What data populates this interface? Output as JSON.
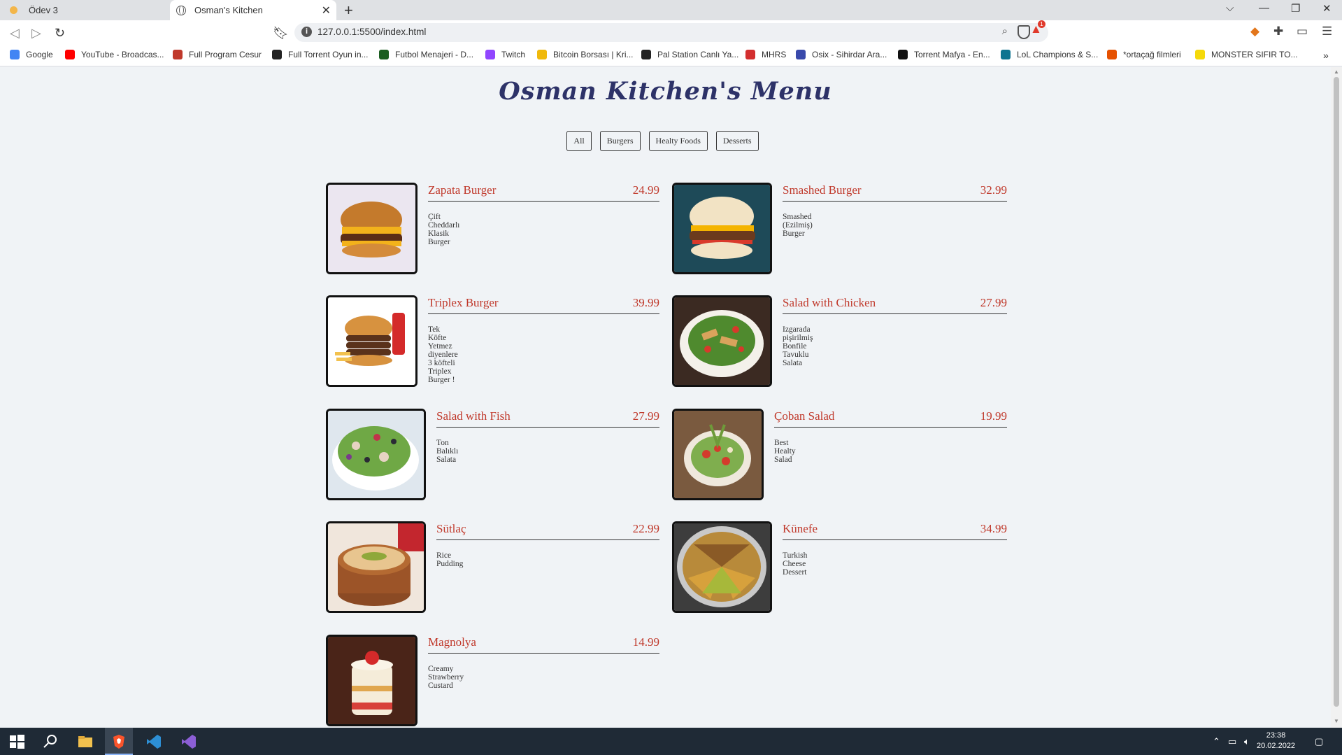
{
  "browser": {
    "tabs": [
      {
        "label": "Ödev 3",
        "active": false
      },
      {
        "label": "Osman's Kitchen",
        "active": true
      }
    ],
    "url": "127.0.0.1:5500/index.html",
    "brave_badge_count": "1",
    "bookmarks": [
      {
        "label": "Google",
        "icon": "google-icon",
        "color": "#4285f4"
      },
      {
        "label": "YouTube - Broadcas...",
        "icon": "youtube-icon",
        "color": "#ff0000"
      },
      {
        "label": "Full Program Cesur",
        "icon": "program-icon",
        "color": "#c0392b"
      },
      {
        "label": "Full Torrent Oyun in...",
        "icon": "globe-icon",
        "color": "#222222"
      },
      {
        "label": "Futbol Menajeri - D...",
        "icon": "football-icon",
        "color": "#1b5e20"
      },
      {
        "label": "Twitch",
        "icon": "twitch-icon",
        "color": "#9146ff"
      },
      {
        "label": "Bitcoin Borsası | Kri...",
        "icon": "binance-icon",
        "color": "#f0b90b"
      },
      {
        "label": "Pal Station Canlı Ya...",
        "icon": "globe-icon",
        "color": "#222222"
      },
      {
        "label": "MHRS",
        "icon": "mhrs-icon",
        "color": "#d32f2f"
      },
      {
        "label": "Osix - Sihirdar Ara...",
        "icon": "osix-icon",
        "color": "#3949ab"
      },
      {
        "label": "Torrent Mafya - En...",
        "icon": "mafia-icon",
        "color": "#111111"
      },
      {
        "label": "LoL Champions & S...",
        "icon": "lol-icon",
        "color": "#0e7490"
      },
      {
        "label": "*ortaçağ filmleri",
        "icon": "film-icon",
        "color": "#e65100"
      },
      {
        "label": "MONSTER SIFIR TO...",
        "icon": "monster-icon",
        "color": "#f5d90a"
      }
    ]
  },
  "page": {
    "title": "Osman Kitchen's Menu",
    "filters": [
      "All",
      "Burgers",
      "Healty Foods",
      "Desserts"
    ],
    "items": [
      {
        "name": "Zapata Burger",
        "price": "24.99",
        "desc": "Çift Cheddarlı Klasik Burger",
        "image": "burger-photo"
      },
      {
        "name": "Smashed Burger",
        "price": "32.99",
        "desc": "Smashed (Ezilmiş) Burger",
        "image": "burger-photo"
      },
      {
        "name": "Triplex Burger",
        "price": "39.99",
        "desc": "Tek Köfte Yetmez diyenlere 3 köfteli Triplex Burger !",
        "image": "burger-photo"
      },
      {
        "name": "Salad with Chicken",
        "price": "27.99",
        "desc": "Izgarada pişirilmiş Bonfile Tavuklu Salata",
        "image": "salad-photo"
      },
      {
        "name": "Salad with Fish",
        "price": "27.99",
        "desc": "Ton Balıklı Salata",
        "image": "salad-photo"
      },
      {
        "name": "Çoban Salad",
        "price": "19.99",
        "desc": "Best Healty Salad",
        "image": "salad-photo"
      },
      {
        "name": "Sütlaç",
        "price": "22.99",
        "desc": "Rice Pudding",
        "image": "dessert-photo"
      },
      {
        "name": "Künefe",
        "price": "34.99",
        "desc": "Turkish Cheese Dessert",
        "image": "dessert-photo"
      },
      {
        "name": "Magnolya",
        "price": "14.99",
        "desc": "Creamy Strawberry Custard",
        "image": "dessert-photo"
      }
    ]
  },
  "taskbar": {
    "time": "23:38",
    "date": "20.02.2022"
  },
  "colors": {
    "page_background": "#f0f3f6",
    "title": "#2d3268",
    "item_name_and_price": "#c0392b"
  }
}
